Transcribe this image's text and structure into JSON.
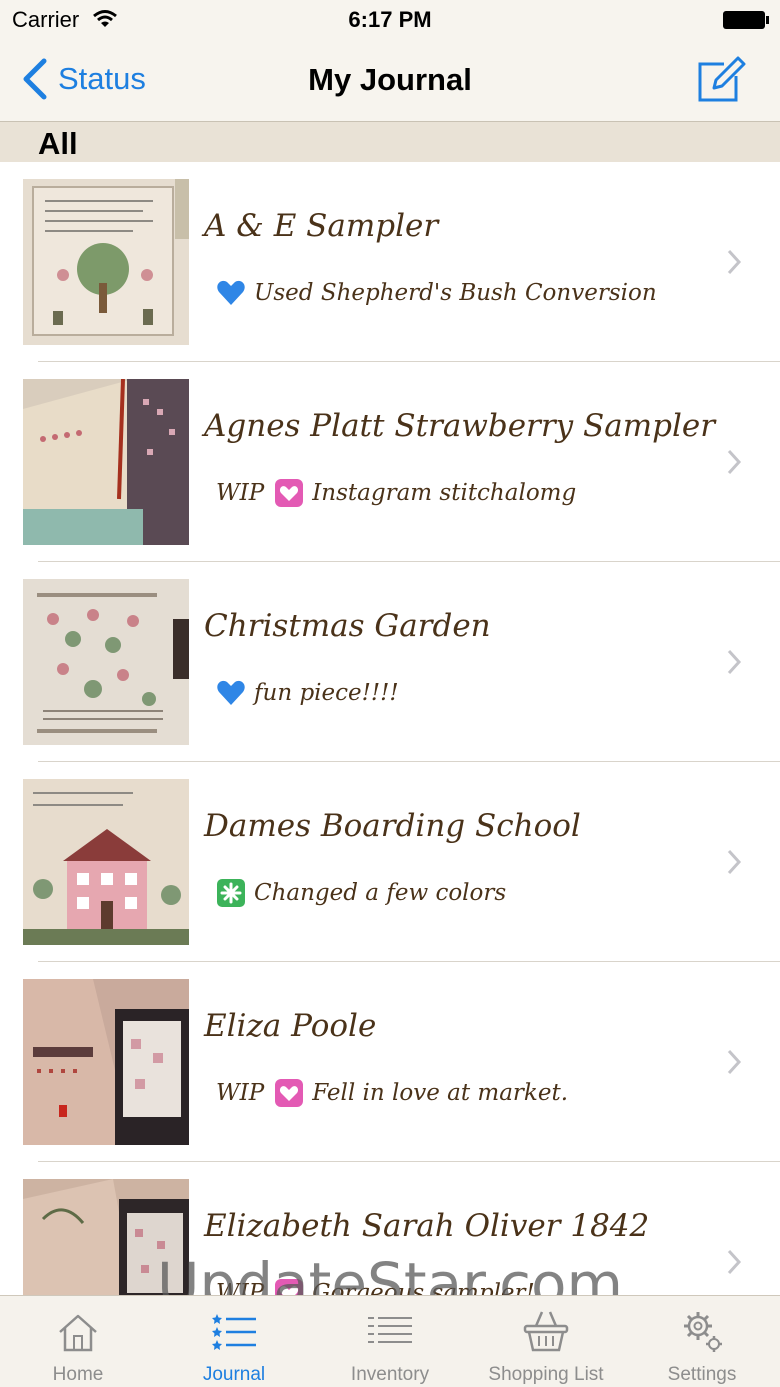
{
  "status_bar": {
    "carrier": "Carrier",
    "time": "6:17 PM"
  },
  "nav": {
    "back_label": "Status",
    "title": "My Journal",
    "compose_icon": "compose-icon"
  },
  "section": {
    "label": "All"
  },
  "colors": {
    "accent": "#1e7fe0",
    "text_brown": "#4a3219",
    "bar_background": "#f7f4ee",
    "section_background": "#e9e2d6"
  },
  "rows": [
    {
      "title": "A & E Sampler",
      "tag": "",
      "icon": "blue-heart-icon",
      "note": "Used Shepherd's Bush Conversion"
    },
    {
      "title": "Agnes Platt Strawberry Sampler",
      "tag": "WIP",
      "icon": "pink-heart-icon",
      "note": "Instagram stitchalomg"
    },
    {
      "title": "Christmas Garden",
      "tag": "",
      "icon": "blue-heart-icon",
      "note": "fun piece!!!!"
    },
    {
      "title": "Dames Boarding School",
      "tag": "",
      "icon": "green-sparkle-icon",
      "note": "Changed a few colors"
    },
    {
      "title": "Eliza Poole",
      "tag": "WIP",
      "icon": "pink-heart-icon",
      "note": "Fell in love at market."
    },
    {
      "title": "Elizabeth Sarah Oliver 1842",
      "tag": "WIP",
      "icon": "pink-heart-icon",
      "note": "Gorgeous sampler!"
    }
  ],
  "watermark": "UpdateStar.com",
  "tabs": [
    {
      "label": "Home",
      "icon": "home-icon"
    },
    {
      "label": "Journal",
      "icon": "journal-list-icon",
      "active": true
    },
    {
      "label": "Inventory",
      "icon": "inventory-list-icon"
    },
    {
      "label": "Shopping List",
      "icon": "basket-icon"
    },
    {
      "label": "Settings",
      "icon": "gear-icon"
    }
  ]
}
